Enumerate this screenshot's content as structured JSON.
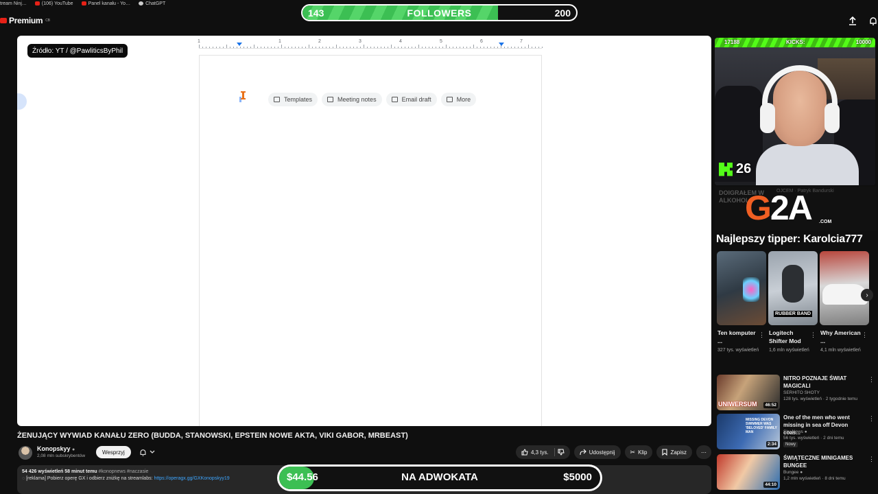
{
  "browser": {
    "bookmarks": [
      "tream Ninj…",
      "(106) YouTube",
      "Panel kanału - Yo…",
      "ChatGPT"
    ]
  },
  "header": {
    "logo_text": "Premium",
    "logo_sup": "CB"
  },
  "followers_bar": {
    "current": "143",
    "label": "FOLLOWERS",
    "goal": "200",
    "progress": 0.715,
    "fill_color": "#3cbf53"
  },
  "video": {
    "source_tag": "Źródło: YT / @PawliticsByPhil",
    "ruler_numbers": [
      "1",
      "1",
      "2",
      "3",
      "4",
      "5",
      "6",
      "7"
    ],
    "chips": [
      {
        "label": "Templates",
        "icon": "template-icon"
      },
      {
        "label": "Meeting notes",
        "icon": "document-icon"
      },
      {
        "label": "Email draft",
        "icon": "email-icon"
      },
      {
        "label": "More",
        "icon": "more-icon"
      }
    ]
  },
  "video_info": {
    "title": "ŻENUJĄCY WYWIAD KANAŁU ZERO (BUDDA, STANOWSKI, EPSTEIN NOWE AKTA, VIKI GABOR, MRBEAST)",
    "channel_name": "Konopskyy",
    "subscribers": "2,08 mln subskrybentów",
    "support_label": "Wesprzyj",
    "likes": "4,3 tys.",
    "share_label": "Udostępnij",
    "clip_label": "Klip",
    "save_label": "Zapisz",
    "views_line": "54 426 wyświetleń  58 minut temu",
    "hashtags": "#konopnews #naczasie",
    "promo_text": "[reklama] Pobierz operę GX i odbierz zniżkę na streamlabs: ",
    "promo_link": "https://operagx.gg/GXKonopskyy19"
  },
  "donation_bar": {
    "current": "$44.56",
    "label": "NA ADWOKATA",
    "goal": "$5000",
    "progress": 0.0089,
    "fill_color": "#3cbf53"
  },
  "webcam": {
    "bar_left": "17188",
    "bar_mid": "KICKS:",
    "bar_right": "10000",
    "kick_count": "26",
    "kick_color": "#53fc18"
  },
  "sponsor": {
    "bg_text_1": "DOIGRAŁEM W",
    "bg_text_2": "ALKOHOL",
    "bg_text_3": "OJCEM · Patryk Bandurski",
    "logo_g": "G",
    "logo_2": "2",
    "logo_a": "A",
    "logo_com": ".COM"
  },
  "tipper": "Najlepszy tipper: Karolcia777",
  "shorts": [
    {
      "title": "Ten komputer ...",
      "views": "327 tys. wyświetleń",
      "caption": ""
    },
    {
      "title": "Logitech Shifter Mod",
      "views": "1,6 mln wyświetleń",
      "caption": "RUBBER BAND"
    },
    {
      "title": "Why American ...",
      "views": "4,1 mln wyświetleń",
      "caption": ""
    }
  ],
  "recommended": [
    {
      "title": "NITRO POZNAJE ŚWIAT MAGICALI",
      "channel": "SERHITO SHOTY",
      "meta": "128 tys. wyświetleń · 2 tygodnie temu",
      "badge": "",
      "duration": "46:52",
      "thumb_text": "UNIWERSUM"
    },
    {
      "title": "One of the men who went missing in sea off Devon coas...",
      "channel": "Sky News",
      "meta": "56 tys. wyświetleń · 2 dni temu",
      "badge": "Nowy",
      "duration": "2:34",
      "thumb_text": "MISSING DEVON SWIMMER WAS 'BELOVED' FAMILY MAN"
    },
    {
      "title": "ŚWIĄTECZNE MINIGAMES BUNGEE",
      "channel": "Bungee",
      "meta": "1,2 mln wyświetleń · 8 dni temu",
      "badge": "",
      "duration": "44:10",
      "thumb_text": ""
    }
  ]
}
